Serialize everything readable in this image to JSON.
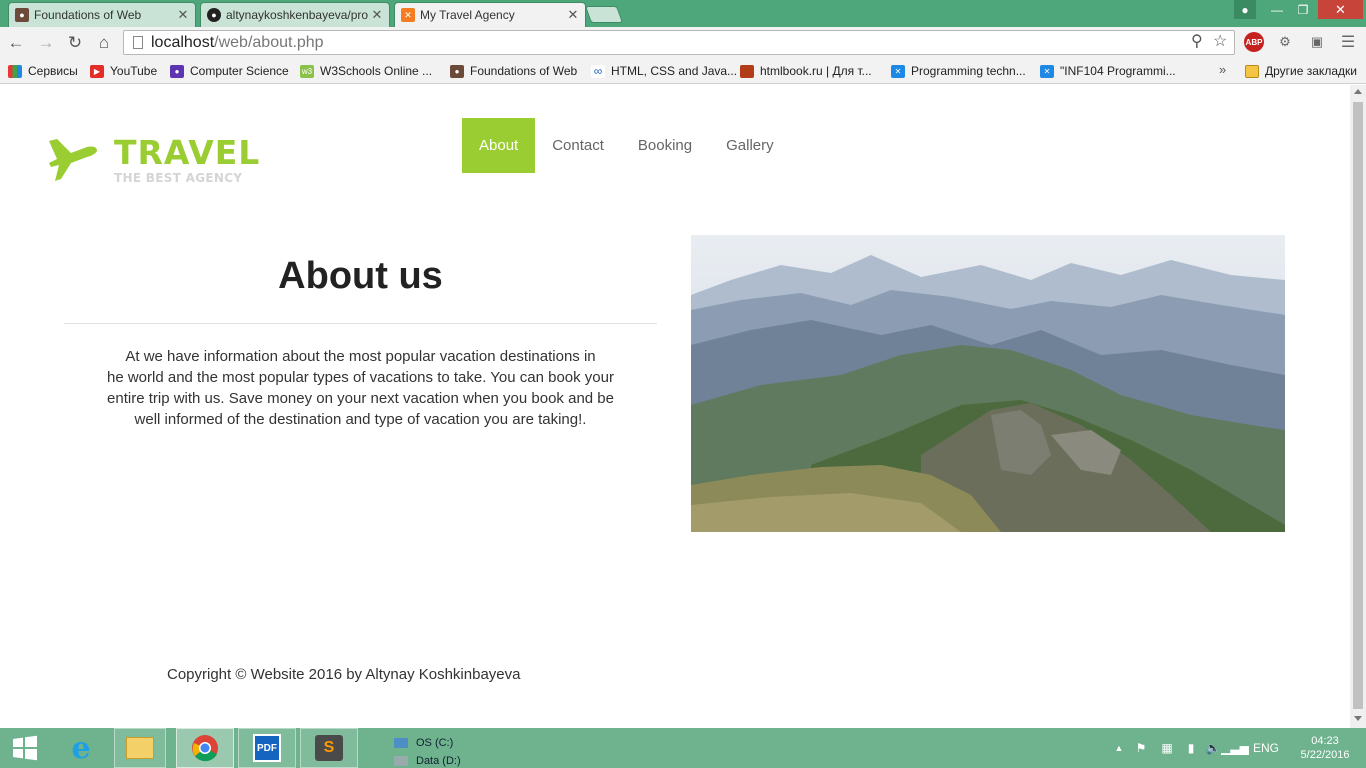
{
  "browser": {
    "tabs": [
      {
        "title": "Foundations of Web",
        "active": false,
        "icon": "person-icon"
      },
      {
        "title": "altynaykoshkenbayeva/pro",
        "active": false,
        "icon": "github-icon"
      },
      {
        "title": "My Travel Agency",
        "active": true,
        "icon": "xampp-icon"
      }
    ],
    "url_host": "localhost",
    "url_path": "/web/about.php",
    "bookmarks": [
      {
        "label": "Сервисы",
        "icon": "apps-grid-icon"
      },
      {
        "label": "YouTube",
        "icon": "youtube-icon"
      },
      {
        "label": "Computer Science",
        "icon": "person-icon"
      },
      {
        "label": "W3Schools Online ...",
        "icon": "w3schools-icon"
      },
      {
        "label": "Foundations of Web",
        "icon": "person-icon"
      },
      {
        "label": "HTML, CSS and Java...",
        "icon": "link-icon"
      },
      {
        "label": "htmlbook.ru | Для т...",
        "icon": "htmlbook-icon"
      },
      {
        "label": "Programming techn...",
        "icon": "x-icon"
      },
      {
        "label": "\"INF104 Programmi...",
        "icon": "x-icon"
      }
    ],
    "other_bookmarks": "Другие закладки"
  },
  "site": {
    "logo_title": "TRAVEL",
    "logo_subtitle": "THE BEST AGENCY",
    "nav": [
      {
        "label": "About",
        "active": true
      },
      {
        "label": "Contact",
        "active": false
      },
      {
        "label": "Booking",
        "active": false
      },
      {
        "label": "Gallery",
        "active": false
      }
    ],
    "about_title": "About us",
    "about_lines": [
      "At we have information about the most popular vacation destinations in",
      "he world and the most popular types of vacations to take. You can book your",
      "entire trip with us. Save money on your next vacation when you book and be",
      "well informed of the destination and type of vacation you are taking!."
    ],
    "copyright": "Copyright © Website 2016 by Altynay Koshkinbayeva",
    "accent_color": "#9acd32"
  },
  "taskbar": {
    "drives": [
      "OS (C:)",
      "Data (D:)"
    ],
    "language": "ENG",
    "time": "04:23",
    "date": "5/22/2016"
  }
}
